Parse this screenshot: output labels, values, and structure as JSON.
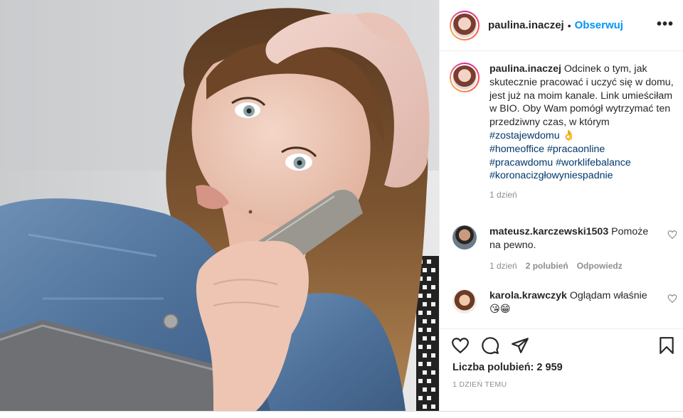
{
  "post": {
    "username": "paulina.inaczej",
    "follow_label": "Obserwuj",
    "separator": "•",
    "more_label": "•••"
  },
  "caption": {
    "username": "paulina.inaczej",
    "text": "Odcinek o tym, jak skutecznie pracować i uczyć się w domu, jest już na moim kanale. Link umieściłam w BIO. Oby Wam pomógł wytrzymać ten przedziwny czas, w którym",
    "hashtags": [
      "#zostajewdomu",
      "#homeoffice",
      "#pracaonline",
      "#pracawdomu",
      "#worklifebalance",
      "#koronacizgłowyniespadnie"
    ],
    "emoji": "👌",
    "time": "1 dzień"
  },
  "comments": [
    {
      "username": "mateusz.karczewski1503",
      "text": "Pomoże na pewno.",
      "time": "1 dzień",
      "likes": "2 polubień",
      "reply_label": "Odpowiedz"
    },
    {
      "username": "karola.krawczyk",
      "text": "Oglądam właśnie 😘😁",
      "time": "",
      "likes": "",
      "reply_label": ""
    }
  ],
  "actions": {
    "like_icon": "heart-icon",
    "comment_icon": "comment-icon",
    "share_icon": "paper-plane-icon",
    "save_icon": "bookmark-icon"
  },
  "likes_text": "Liczba polubień: 2 959",
  "posted_text": "1 DZIEŃ TEMU",
  "colors": {
    "link": "#0095f6",
    "hashtag": "#00376b",
    "muted": "#8e8e8e",
    "text": "#262626"
  }
}
